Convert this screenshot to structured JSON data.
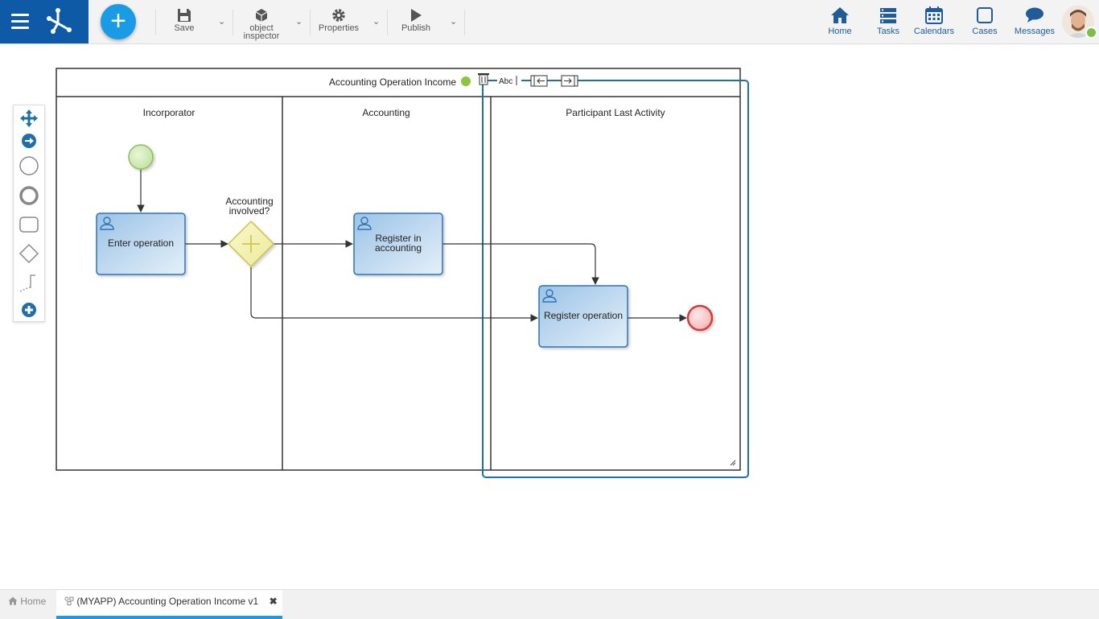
{
  "toolbar": {
    "save": "Save",
    "object_inspector_line1": "object",
    "object_inspector_line2": "inspector",
    "properties": "Properties",
    "publish": "Publish"
  },
  "nav": {
    "home": "Home",
    "tasks": "Tasks",
    "calendars": "Calendars",
    "cases": "Cases",
    "messages": "Messages"
  },
  "diagram": {
    "pool_title": "Accounting Operation Income",
    "title_editor_text": "Abc",
    "lanes": [
      "Incorporator",
      "Accounting",
      "Participant Last Activity"
    ],
    "gateway_label_line1": "Accounting",
    "gateway_label_line2": "involved?",
    "task_enter": "Enter operation",
    "task_register_line1": "Register in",
    "task_register_line2": "accounting",
    "task_operation": "Register operation"
  },
  "bottom_tabs": {
    "home": "Home",
    "process": "(MYAPP) Accounting Operation Income v1"
  },
  "colors": {
    "brand": "#0e5aa7",
    "accent": "#1a9be6",
    "selection": "#1f6fa8",
    "task_fill": "#bcd7ee",
    "gateway_fill": "#f7f3b0",
    "start_fill": "#cfe8b2",
    "end_fill": "#f7caca"
  }
}
